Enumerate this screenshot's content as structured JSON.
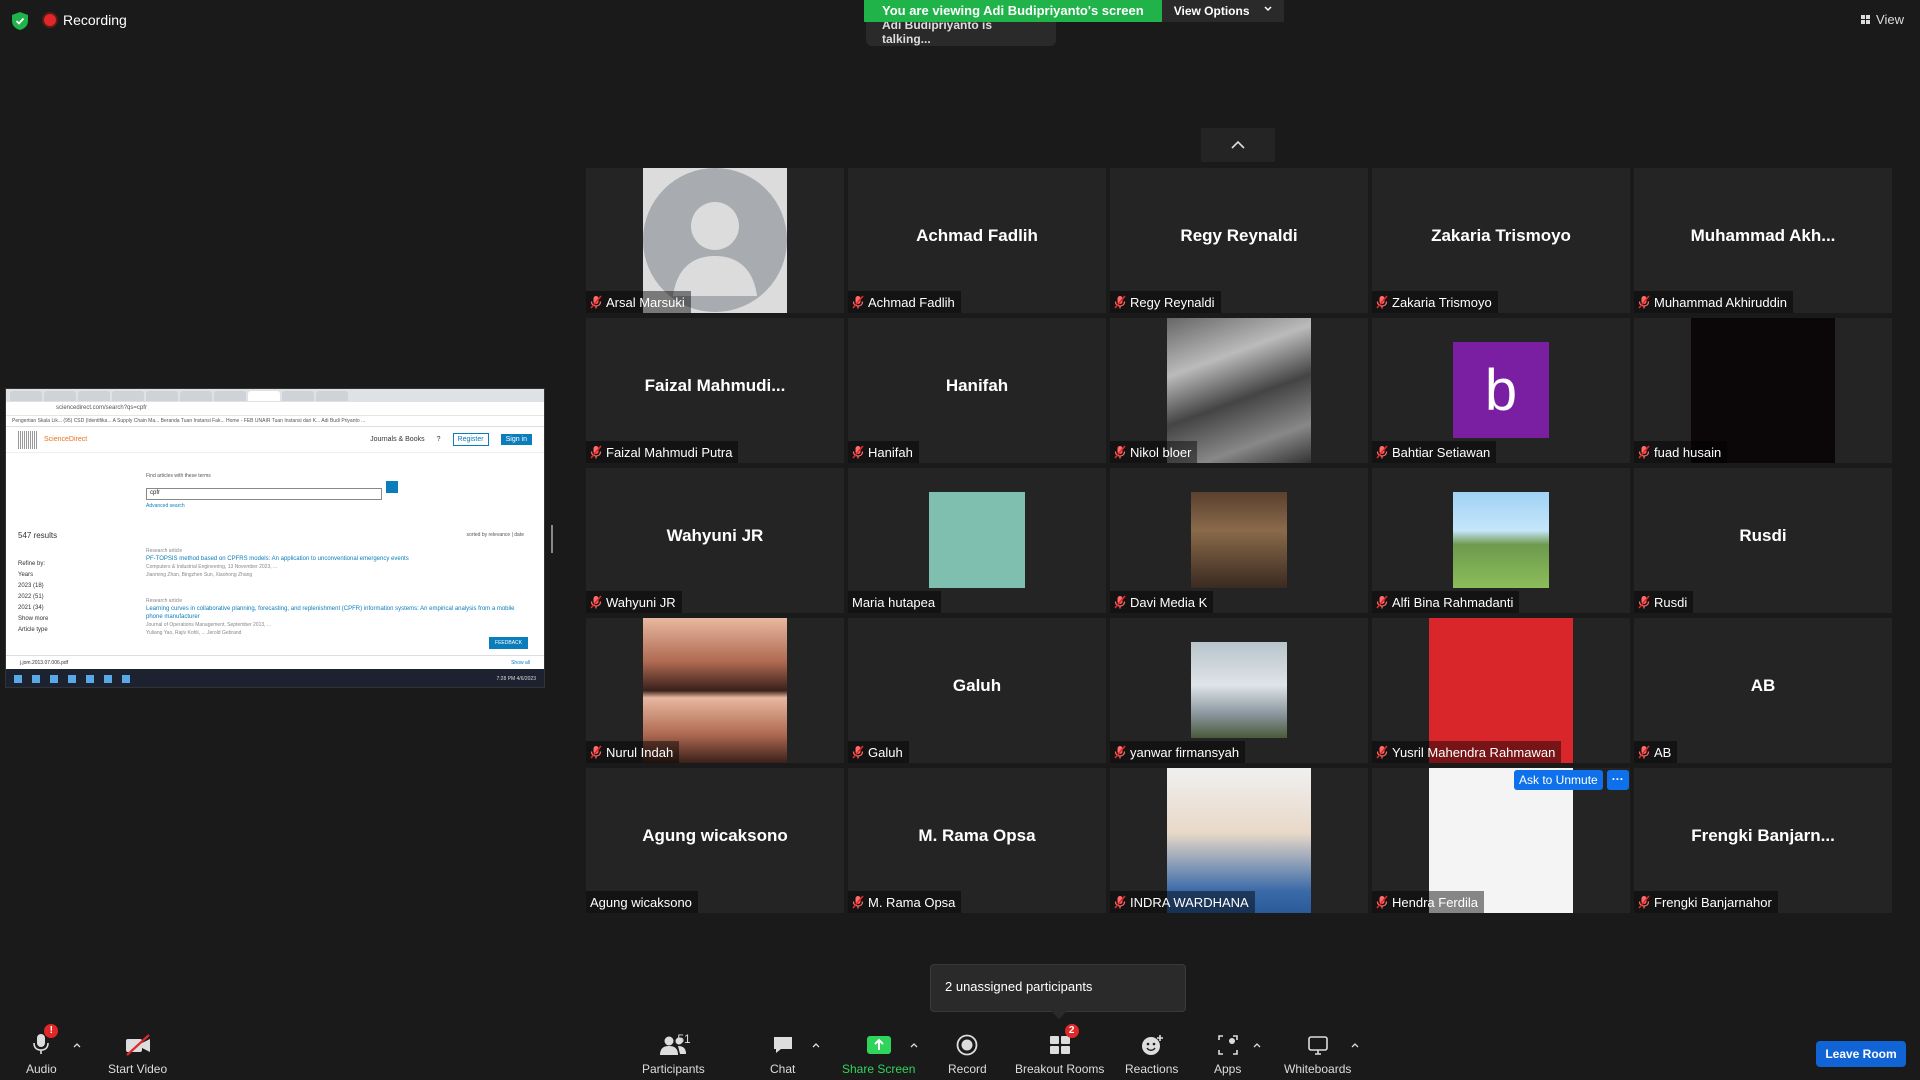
{
  "top": {
    "recording_label": "Recording",
    "viewing_banner": "You are viewing Adi Budipriyanto's screen",
    "view_options_label": "View Options",
    "talking_text": "Adi Budipriyanto is talking...",
    "view_label": "View"
  },
  "shared_screen": {
    "address": "sciencedirect.com/search?qs=cpfr",
    "bookmarks": "Pengertian Skala Lik...   (95) CSD (Identifika...   A Supply Chain Ma...   Beranda   Tuan Instansi Fak...   Home - FEB UNAIR   Tuan Instansi dari K...   Adi Budi Priyanto ...",
    "logo_text": "ScienceDirect",
    "journals_label": "Journals & Books",
    "register_label": "Register",
    "signin_label": "Sign in",
    "search_label": "Find articles with these terms",
    "search_value": "cpfr",
    "advanced_label": "Advanced search",
    "results_count": "547 results",
    "sorted_label": "sorted by relevance | date",
    "refine_label": "Refine by:",
    "years_label": "Years",
    "year_items": [
      "2023 (18)",
      "2022 (51)",
      "2021 (34)"
    ],
    "show_more": "Show more",
    "article_type": "Article type",
    "articles": [
      {
        "kind": "Research article",
        "title": "PF-TOPSIS method based on CPFRS models: An application to unconventional emergency events",
        "meta": "Computers & Industrial Engineering, 13 November 2023, ...",
        "authors": "Jianming Zhan, Bingzhen Sun, Xiaohong Zhang"
      },
      {
        "kind": "Research article",
        "title": "Learning curves in collaborative planning, forecasting, and replenishment (CPFR) information systems: An empirical analysis from a mobile phone manufacturer",
        "meta": "Journal of Operations Management, September 2013, ...",
        "authors": "Yuliang Yao, Rajiv Kohli, ... Jerold Gebrand"
      }
    ],
    "feedback_label": "FEEDBACK",
    "download_file": "j.jom.2013.07.006.pdf",
    "show_all": "Show all",
    "clock": "7:28 PM\n4/6/2023"
  },
  "participants": [
    {
      "big": "",
      "name": "Arsal Marsuki",
      "muted": true,
      "photo": "avatar"
    },
    {
      "big": "Achmad Fadlih",
      "name": "Achmad Fadlih",
      "muted": true,
      "photo": ""
    },
    {
      "big": "Regy Reynaldi",
      "name": "Regy Reynaldi",
      "muted": true,
      "photo": ""
    },
    {
      "big": "Zakaria Trismoyo",
      "name": "Zakaria Trismoyo",
      "muted": true,
      "photo": ""
    },
    {
      "big": "Muhammad  Akh...",
      "name": "Muhammad Akhiruddin",
      "muted": true,
      "photo": ""
    },
    {
      "big": "Faizal  Mahmudi...",
      "name": "Faizal Mahmudi Putra",
      "muted": true,
      "photo": ""
    },
    {
      "big": "Hanifah",
      "name": "Hanifah",
      "muted": true,
      "photo": ""
    },
    {
      "big": "",
      "name": "Nikol bloer",
      "muted": true,
      "photo": "bw"
    },
    {
      "big": "",
      "name": "Bahtiar Setiawan",
      "muted": true,
      "photo": "b",
      "initial": "b"
    },
    {
      "big": "",
      "name": "fuad husain",
      "muted": true,
      "photo": "dark"
    },
    {
      "big": "Wahyuni JR",
      "name": "Wahyuni JR",
      "muted": true,
      "photo": ""
    },
    {
      "big": "",
      "name": "Maria hutapea",
      "muted": false,
      "photo": "piano"
    },
    {
      "big": "",
      "name": "Davi Media K",
      "muted": true,
      "photo": "cafe"
    },
    {
      "big": "",
      "name": "Alfi Bina Rahmadanti",
      "muted": true,
      "photo": "park"
    },
    {
      "big": "Rusdi",
      "name": "Rusdi",
      "muted": true,
      "photo": ""
    },
    {
      "big": "",
      "name": "Nurul Indah",
      "muted": true,
      "photo": "girl"
    },
    {
      "big": "Galuh",
      "name": "Galuh",
      "muted": true,
      "photo": ""
    },
    {
      "big": "",
      "name": "yanwar firmansyah",
      "muted": true,
      "photo": "cloud"
    },
    {
      "big": "",
      "name": "Yusril Mahendra Rahmawan",
      "muted": true,
      "photo": "red"
    },
    {
      "big": "AB",
      "name": "AB",
      "muted": true,
      "photo": ""
    },
    {
      "big": "Agung wicaksono",
      "name": "Agung wicaksono",
      "muted": false,
      "photo": ""
    },
    {
      "big": "M. Rama Opsa",
      "name": "M. Rama Opsa",
      "muted": true,
      "photo": ""
    },
    {
      "big": "",
      "name": "INDRA WARDHANA",
      "muted": true,
      "photo": "lite"
    },
    {
      "big": "",
      "name": "Hendra Ferdila",
      "muted": true,
      "photo": "white",
      "ask": true
    },
    {
      "big": "Frengki  Banjarn...",
      "name": "Frengki Banjarnahor",
      "muted": true,
      "photo": ""
    }
  ],
  "ask_to_unmute_label": "Ask to Unmute",
  "more_label": "···",
  "unassigned_text": "2 unassigned participants",
  "toolbar": {
    "audio": "Audio",
    "video": "Start Video",
    "participants": "Participants",
    "participants_count": "51",
    "chat": "Chat",
    "share": "Share Screen",
    "record": "Record",
    "breakout": "Breakout Rooms",
    "breakout_badge": "2",
    "reactions": "Reactions",
    "apps": "Apps",
    "whiteboards": "Whiteboards",
    "leave": "Leave Room",
    "audio_badge": "!"
  },
  "colors": {
    "accent_green": "#1fb34a",
    "accent_blue": "#0e71eb",
    "mute_red": "#e02828"
  }
}
